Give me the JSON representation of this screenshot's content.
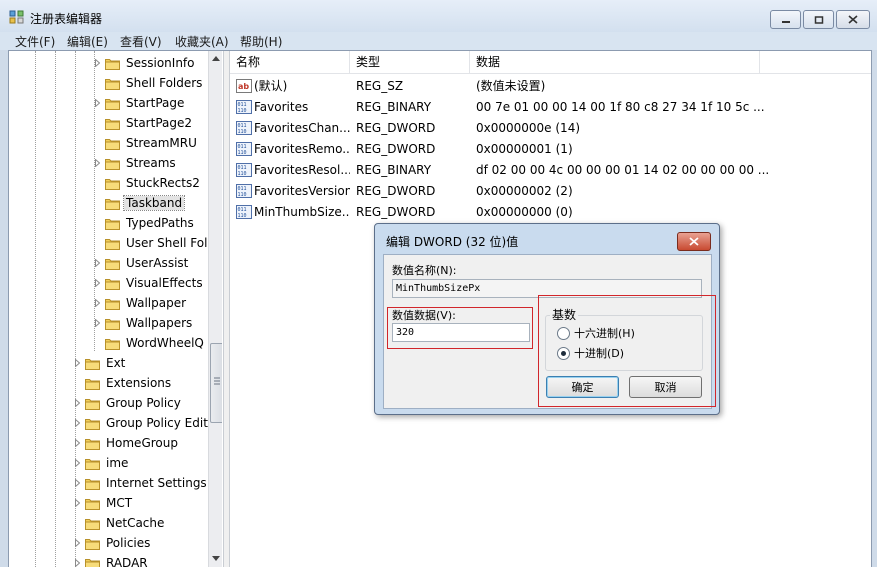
{
  "window": {
    "title": "注册表编辑器"
  },
  "menu": [
    "文件(F)",
    "编辑(E)",
    "查看(V)",
    "收藏夹(A)",
    "帮助(H)"
  ],
  "tree": [
    {
      "label": "SessionInfo",
      "level": 2,
      "expander": true
    },
    {
      "label": "Shell Folders",
      "level": 2,
      "expander": false
    },
    {
      "label": "StartPage",
      "level": 2,
      "expander": true
    },
    {
      "label": "StartPage2",
      "level": 2,
      "expander": false
    },
    {
      "label": "StreamMRU",
      "level": 2,
      "expander": false
    },
    {
      "label": "Streams",
      "level": 2,
      "expander": true
    },
    {
      "label": "StuckRects2",
      "level": 2,
      "expander": false
    },
    {
      "label": "Taskband",
      "level": 2,
      "expander": false,
      "selected": true
    },
    {
      "label": "TypedPaths",
      "level": 2,
      "expander": false
    },
    {
      "label": "User Shell Fol",
      "level": 2,
      "expander": false
    },
    {
      "label": "UserAssist",
      "level": 2,
      "expander": true
    },
    {
      "label": "VisualEffects",
      "level": 2,
      "expander": true
    },
    {
      "label": "Wallpaper",
      "level": 2,
      "expander": true
    },
    {
      "label": "Wallpapers",
      "level": 2,
      "expander": true
    },
    {
      "label": "WordWheelQ",
      "level": 2,
      "expander": false
    },
    {
      "label": "Ext",
      "level": 1,
      "expander": true
    },
    {
      "label": "Extensions",
      "level": 1,
      "expander": false
    },
    {
      "label": "Group Policy",
      "level": 1,
      "expander": true
    },
    {
      "label": "Group Policy Edit",
      "level": 1,
      "expander": true
    },
    {
      "label": "HomeGroup",
      "level": 1,
      "expander": true
    },
    {
      "label": "ime",
      "level": 1,
      "expander": true
    },
    {
      "label": "Internet Settings",
      "level": 1,
      "expander": true
    },
    {
      "label": "MCT",
      "level": 1,
      "expander": true
    },
    {
      "label": "NetCache",
      "level": 1,
      "expander": false
    },
    {
      "label": "Policies",
      "level": 1,
      "expander": true
    },
    {
      "label": "RADAR",
      "level": 1,
      "expander": true
    }
  ],
  "list": {
    "columns": [
      "名称",
      "类型",
      "数据"
    ],
    "rows": [
      {
        "name": "(默认)",
        "type": "REG_SZ",
        "data": "(数值未设置)",
        "icon": "ab-string-icon"
      },
      {
        "name": "Favorites",
        "type": "REG_BINARY",
        "data": "00 7e 01 00 00 14 00 1f 80 c8 27 34 1f 10 5c ...",
        "icon": "binary-value-icon"
      },
      {
        "name": "FavoritesChan...",
        "type": "REG_DWORD",
        "data": "0x0000000e (14)",
        "icon": "binary-value-icon"
      },
      {
        "name": "FavoritesRemo...",
        "type": "REG_DWORD",
        "data": "0x00000001 (1)",
        "icon": "binary-value-icon"
      },
      {
        "name": "FavoritesResol...",
        "type": "REG_BINARY",
        "data": "df 02 00 00 4c 00 00 00 01 14 02 00 00 00 00 ...",
        "icon": "binary-value-icon"
      },
      {
        "name": "FavoritesVersion",
        "type": "REG_DWORD",
        "data": "0x00000002 (2)",
        "icon": "binary-value-icon"
      },
      {
        "name": "MinThumbSize...",
        "type": "REG_DWORD",
        "data": "0x00000000 (0)",
        "icon": "binary-value-icon"
      }
    ]
  },
  "dialog": {
    "title": "编辑 DWORD (32 位)值",
    "name_label": "数值名称(N):",
    "name_value": "MinThumbSizePx",
    "data_label": "数值数据(V):",
    "data_value": "320",
    "base_label": "基数",
    "hex_label": "十六进制(H)",
    "dec_label": "十进制(D)",
    "selected_base": "decimal",
    "ok_label": "确定",
    "cancel_label": "取消",
    "highlight_color": "#d1262b"
  }
}
